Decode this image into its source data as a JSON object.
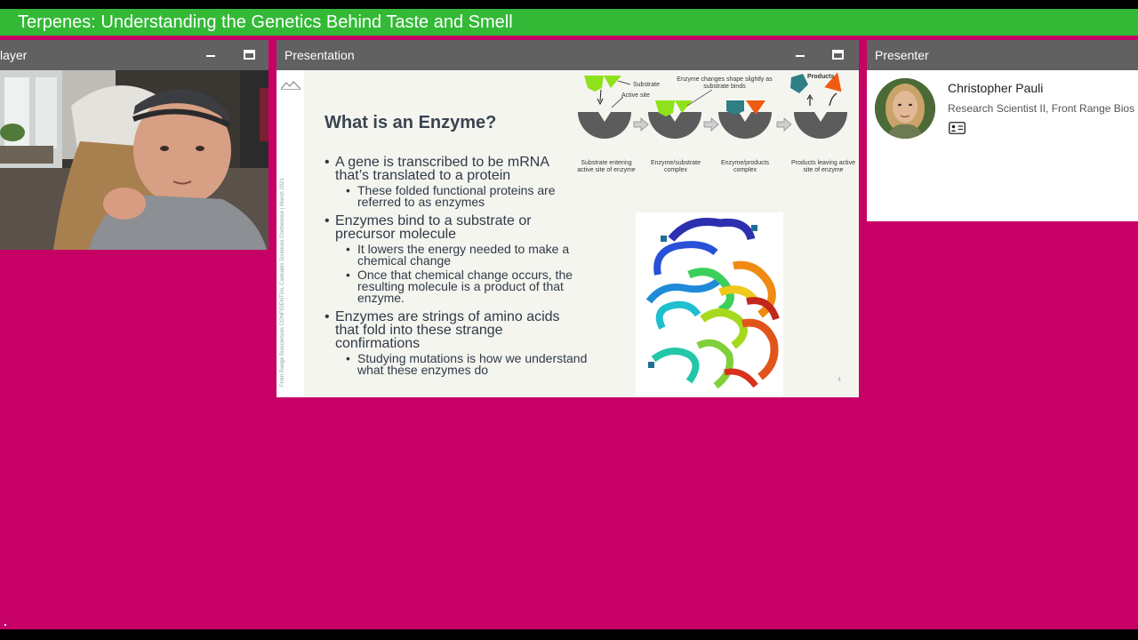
{
  "session": {
    "title": "Terpenes: Understanding the Genetics Behind Taste and Smell"
  },
  "panels": {
    "player": {
      "label": "layer"
    },
    "presentation": {
      "label": "Presentation"
    },
    "presenter": {
      "label": "Presenter"
    }
  },
  "slide": {
    "title": "What is an Enzyme?",
    "bullets": [
      {
        "text": "A gene is transcribed to be mRNA that’s translated to a protein",
        "sub": [
          "These folded functional proteins are referred to as enzymes"
        ]
      },
      {
        "text": "Enzymes bind to a substrate or precursor molecule",
        "sub": [
          "It lowers the energy needed to make a chemical change",
          "Once that chemical change occurs, the resulting molecule is a product of that enzyme."
        ]
      },
      {
        "text": "Enzymes are strings of amino acids that fold into these strange confirmations",
        "sub": [
          "Studying mutations is how we understand what these enzymes do"
        ]
      }
    ],
    "page_number": "4",
    "side_text": "Front Range Biosciences   CONFIDENTIAL   Cannabis Sciences Conference | March 2021",
    "diagram": {
      "substrate_label": "Substrate",
      "active_site_label": "Active site",
      "shape_change_label": "Enzyme changes shape slightly as substrate binds",
      "products_label": "Products",
      "captions": [
        "Substrate entering active site of enzyme",
        "Enzyme/substrate complex",
        "Enzyme/products complex",
        "Products leaving active site of enzyme"
      ]
    }
  },
  "presenter": {
    "name": "Christopher Pauli",
    "role": "Research Scientist II, Front Range Bios"
  },
  "colors": {
    "topbar": "#33b936",
    "background": "#c70066",
    "panel_header": "#616161",
    "substrate": "#8fe21a",
    "product_teal": "#2e7f86",
    "product_orange": "#f15a12",
    "enzyme": "#5c5c5c"
  },
  "icons": [
    "minimize-icon",
    "maximize-icon",
    "contact-card-icon"
  ]
}
